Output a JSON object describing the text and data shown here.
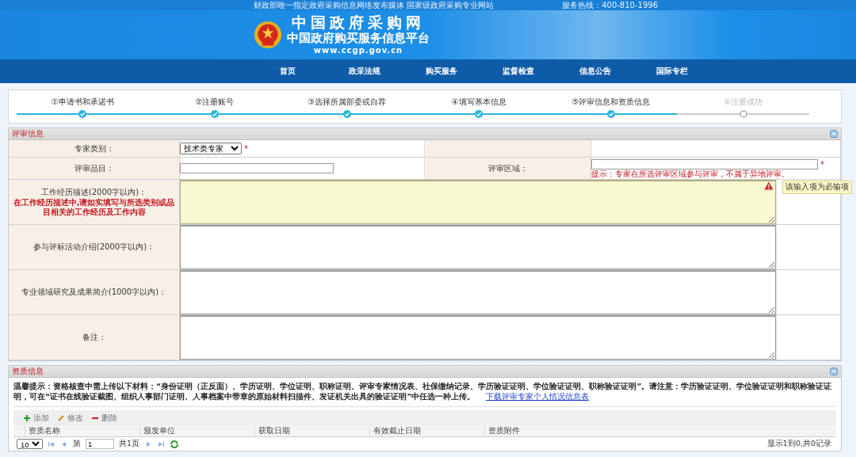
{
  "top_bar": {
    "notice": "财政部唯一指定政府采购信息网络发布媒体 国家级政府采购专业网站",
    "hotline": "服务热线：400-810-1996"
  },
  "header": {
    "title": "中国政府采购网",
    "subtitle": "中国政府购买服务信息平台",
    "url": "www.ccgp.gov.cn"
  },
  "nav": [
    {
      "label": "首页"
    },
    {
      "label": "政采法规"
    },
    {
      "label": "购买服务"
    },
    {
      "label": "监督检查"
    },
    {
      "label": "信息公告"
    },
    {
      "label": "国际专栏"
    }
  ],
  "steps": [
    {
      "label": "①申请书和承诺书",
      "done": true
    },
    {
      "label": "②注册账号",
      "done": true
    },
    {
      "label": "③选择所属部委或自荐",
      "done": true
    },
    {
      "label": "④填写基本信息",
      "done": true
    },
    {
      "label": "⑤评审信息和资质信息",
      "done": true
    },
    {
      "label": "⑥注册成功",
      "done": false
    }
  ],
  "review_section": {
    "title": "评审信息",
    "expert_type": {
      "label": "专家类别：",
      "value": "技术类专家",
      "required_mark": "*"
    },
    "category": {
      "label": "评审品目："
    },
    "region": {
      "label": "评审区域：",
      "required_mark": "*",
      "hint": "提示：专家在所选评审区域参与评审，不属于异地评审。"
    },
    "text_areas": [
      {
        "label": "工作经历描述(2000字以内)：",
        "note": "在工作经历描述中,请如实填写与所选类别或品目相关的工作经历及工作内容",
        "invalid": true,
        "error_tooltip": "该输入项为必输项"
      },
      {
        "label": "参与评标活动介绍(2000字以内)：",
        "invalid": false
      },
      {
        "label": "专业领域研究及成果简介(1000字以内)：",
        "invalid": false
      },
      {
        "label": "备注：",
        "invalid": false
      }
    ]
  },
  "qualification_section": {
    "title": "资质信息",
    "notice": "温馨提示：资格核查中需上传以下材料：“身份证明（正反面）、学历证明、学位证明、职称证明、评审专家情况表、社保缴纳记录、学历验证证明、学位验证证明、职称验证证明”。请注意：学历验证证明、学位验证证明和职称验证证明，可在“证书在线验证截图、组织人事部门证明、人事档案中带章的原始材料扫描件、发证机关出具的验证证明”中任选一种上传。",
    "download_link": "下载评审专家个人情况信息表",
    "toolbar": [
      {
        "kind": "add",
        "label": "添加"
      },
      {
        "kind": "edit",
        "label": "修改"
      },
      {
        "kind": "delete",
        "label": "删除"
      }
    ],
    "columns": [
      "资质名称",
      "颁发单位",
      "获取日期",
      "有效截止日期",
      "资质附件"
    ],
    "pager": {
      "page_size": "10",
      "page_prefix": "第",
      "page": "1",
      "page_total": "共1页",
      "summary": "显示1到0,共0记录"
    }
  }
}
